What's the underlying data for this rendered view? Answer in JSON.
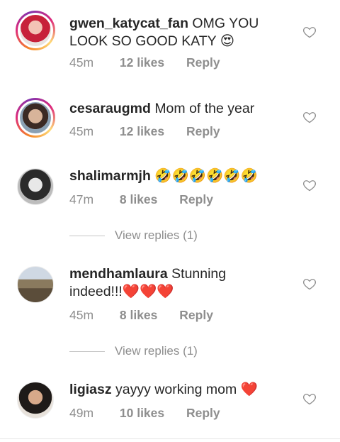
{
  "comments": [
    {
      "username": "gwen_katycat_fan",
      "text": "OMG YOU LOOK SO GOOD KATY 😍⁠⁠",
      "time": "45m",
      "likes": "12 likes",
      "reply": "Reply",
      "story_ring": true
    },
    {
      "username": "cesaraugmd",
      "text": "Mom of the year",
      "time": "45m",
      "likes": "12 likes",
      "reply": "Reply",
      "story_ring": true
    },
    {
      "username": "shalimarmjh",
      "text": "🤣🤣🤣🤣🤣🤣",
      "time": "47m",
      "likes": "8 likes",
      "reply": "Reply",
      "story_ring": false,
      "view_replies": "View replies (1)"
    },
    {
      "username": "mendhamlaura",
      "text": "Stunning indeed!!!❤️❤️❤️",
      "time": "45m",
      "likes": "8 likes",
      "reply": "Reply",
      "story_ring": false,
      "view_replies": "View replies (1)"
    },
    {
      "username": "ligiasz",
      "text": "yayyy working mom ❤️",
      "time": "49m",
      "likes": "10 likes",
      "reply": "Reply",
      "story_ring": false
    }
  ],
  "icons": {
    "like": "heart-outline-icon"
  },
  "colors": {
    "text": "#262626",
    "meta": "#8e8e8e",
    "heart": "#e5202e"
  }
}
